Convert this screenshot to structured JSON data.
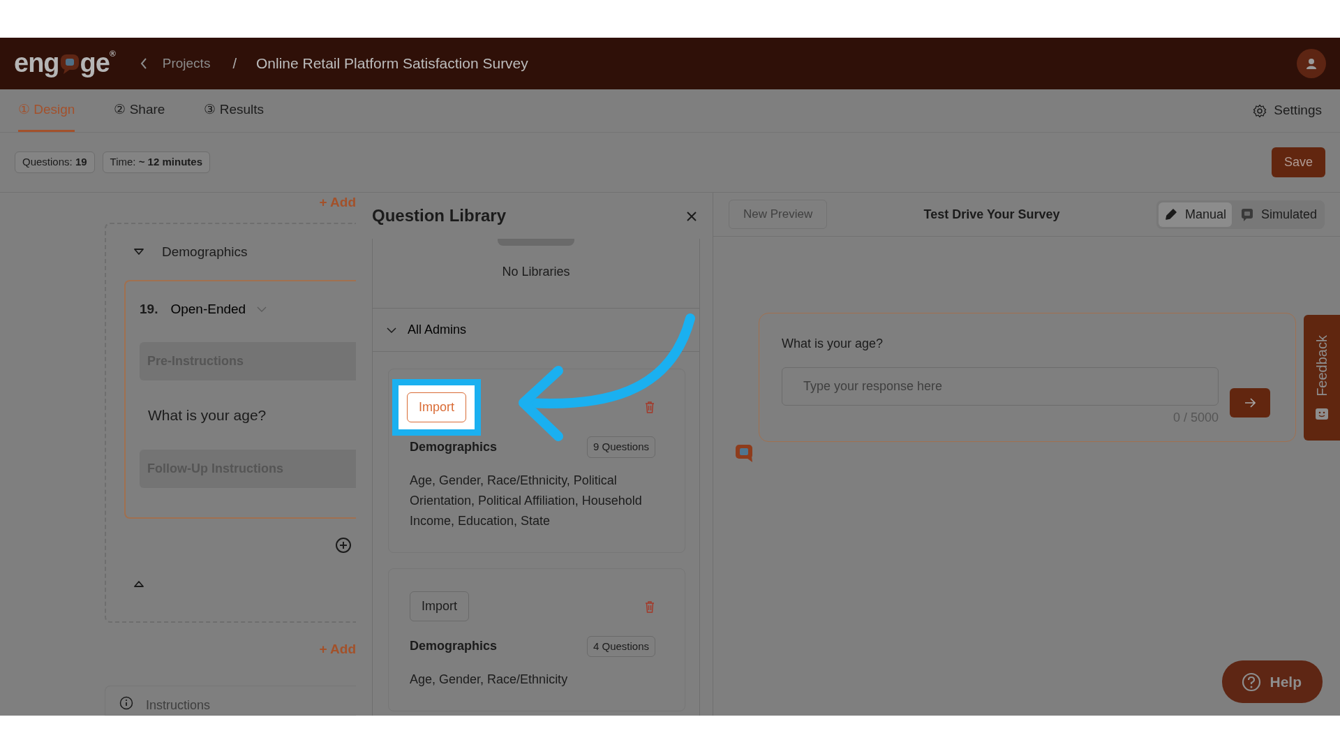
{
  "header": {
    "logo": {
      "parts": [
        "eng",
        "ge"
      ],
      "registered": "®"
    },
    "breadcrumb": "Projects",
    "separator": "/",
    "title": "Online Retail Platform Satisfaction Survey"
  },
  "tabs": [
    {
      "number": "①",
      "label": "Design",
      "selected": true
    },
    {
      "number": "②",
      "label": "Share",
      "selected": false
    },
    {
      "number": "③",
      "label": "Results",
      "selected": false
    }
  ],
  "settings": "Settings",
  "stats": [
    {
      "label": "Questions:",
      "value": "19"
    },
    {
      "label": "Time:",
      "value": "~ 12 minutes"
    }
  ],
  "save": "Save",
  "editor": {
    "add_top": "+ Add",
    "section": {
      "title": "Demographics",
      "expanded": true
    },
    "question": {
      "number": "19.",
      "type": "Open-Ended",
      "pre": "Pre-Instructions",
      "text": "What is your age?",
      "follow": "Follow-Up Instructions"
    },
    "add_bottom": "+ Add",
    "next_block": "Instructions"
  },
  "library": {
    "title": "Question Library",
    "empty_text": "No Libraries",
    "group": {
      "label": "All Admins",
      "expanded": true
    },
    "items": [
      {
        "action": "Import",
        "highlighted": true,
        "name": "Demographics",
        "count": "9 Questions",
        "description": "Age, Gender, Race/Ethnicity, Political Orientation, Political Affiliation, Household Income, Education, State"
      },
      {
        "action": "Import",
        "highlighted": false,
        "name": "Demographics",
        "count": "4 Questions",
        "description": "Age, Gender, Race/Ethnicity"
      }
    ]
  },
  "preview": {
    "new_preview": {
      "label": "New Preview",
      "disabled": true
    },
    "title": "Test Drive Your Survey",
    "modes": [
      {
        "label": "Manual",
        "selected": true
      },
      {
        "label": "Simulated",
        "selected": false
      }
    ],
    "question": "What is your age?",
    "placeholder": "Type your response here",
    "counter": "0 / 5000"
  },
  "feedback": "Feedback",
  "help": "Help"
}
